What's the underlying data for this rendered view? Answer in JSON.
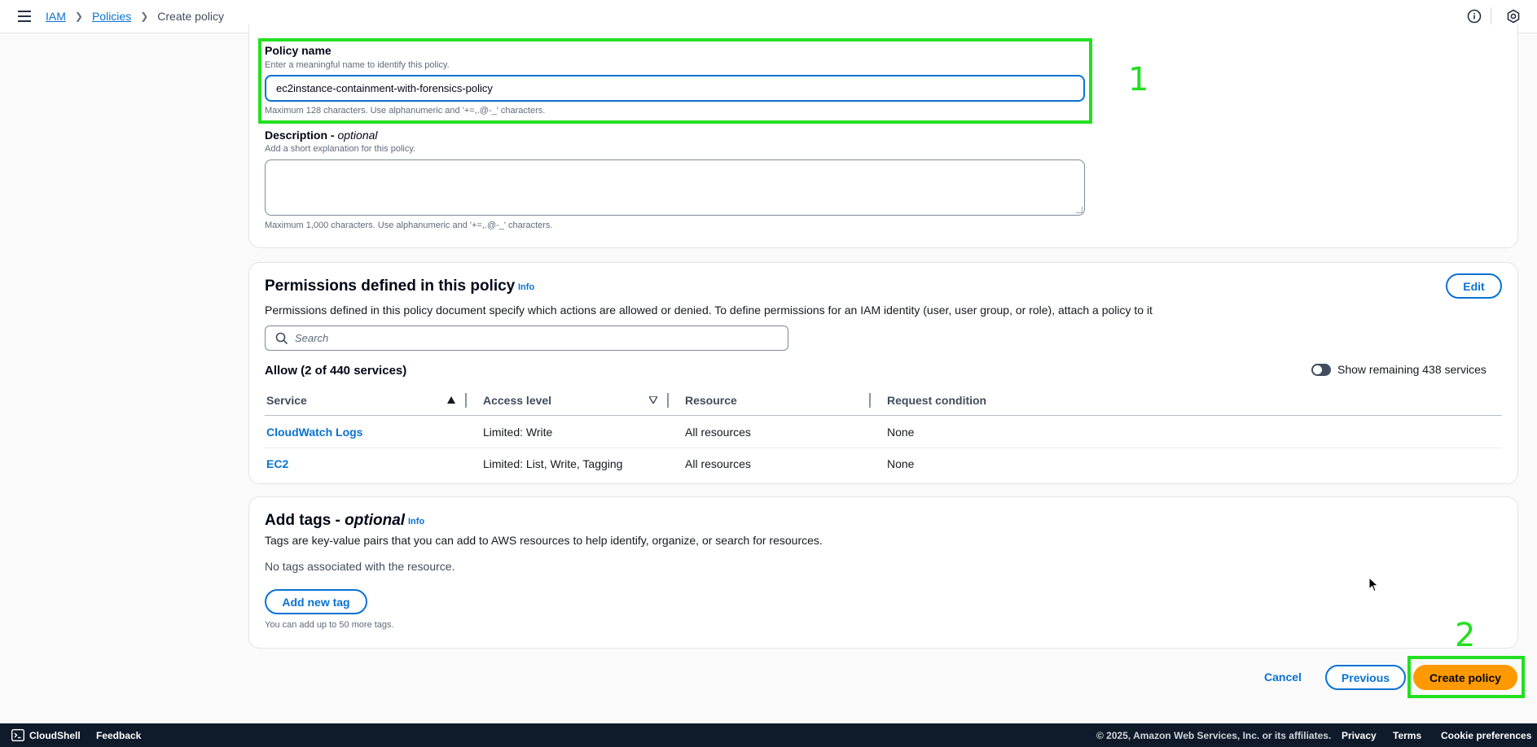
{
  "breadcrumb": {
    "service": "IAM",
    "section": "Policies",
    "current": "Create policy"
  },
  "icons": {
    "menu": "hamburger-icon",
    "info": "info-circle-icon",
    "settings": "settings-hex-icon"
  },
  "policy_details": {
    "name_label": "Policy name",
    "name_hint": "Enter a meaningful name to identify this policy.",
    "name_value": "ec2instance-containment-with-forensics-policy",
    "name_help": "Maximum 128 characters. Use alphanumeric and '+=,.@-_' characters.",
    "description_label": "Description - ",
    "description_optional": "optional",
    "description_hint": "Add a short explanation for this policy.",
    "description_value": "",
    "description_help": "Maximum 1,000 characters. Use alphanumeric and '+=,.@-_' characters."
  },
  "permissions": {
    "title": "Permissions defined in this policy",
    "info": "Info",
    "edit": "Edit",
    "description": "Permissions defined in this policy document specify which actions are allowed or denied. To define permissions for an IAM identity (user, user group, or role), attach a policy to it",
    "search_placeholder": "Search",
    "allow_heading": "Allow (2 of 440 services)",
    "show_remaining": "Show remaining 438 services",
    "show_remaining_enabled": false,
    "columns": [
      "Service",
      "Access level",
      "Resource",
      "Request condition"
    ],
    "rows": [
      {
        "service": "CloudWatch Logs",
        "access": "Limited: Write",
        "resource": "All resources",
        "condition": "None"
      },
      {
        "service": "EC2",
        "access": "Limited: List, Write, Tagging",
        "resource": "All resources",
        "condition": "None"
      }
    ]
  },
  "tags": {
    "title": "Add tags - ",
    "title_optional": "optional",
    "info": "Info",
    "description": "Tags are key-value pairs that you can add to AWS resources to help identify, organize, or search for resources.",
    "empty": "No tags associated with the resource.",
    "add_button": "Add new tag",
    "limit_hint": "You can add up to 50 more tags."
  },
  "actions": {
    "cancel": "Cancel",
    "previous": "Previous",
    "create": "Create policy"
  },
  "annotations": {
    "first": "1",
    "second": "2",
    "color": "#22e01f"
  },
  "footer": {
    "cloudshell": "CloudShell",
    "feedback": "Feedback",
    "copyright": "© 2025, Amazon Web Services, Inc. or its affiliates.",
    "privacy": "Privacy",
    "terms": "Terms",
    "cookies": "Cookie preferences"
  },
  "colors": {
    "link": "#0972d3",
    "primary": "#ff9900",
    "footer_bg": "#0f1b2a"
  }
}
